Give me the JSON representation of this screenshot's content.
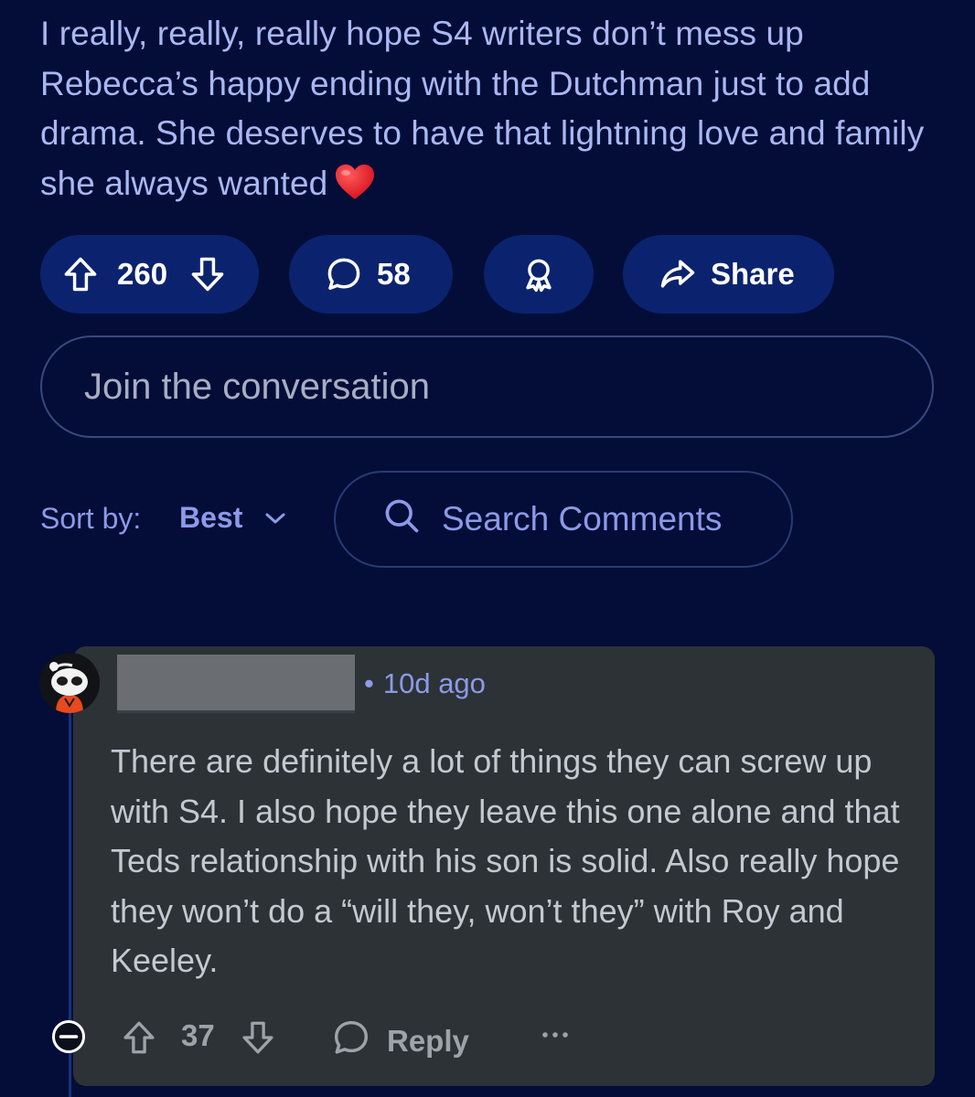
{
  "post": {
    "body": "I really, really, really hope S4 writers don’t mess up Rebecca’s happy ending with the Dutchman just to add drama. She deserves to have that lightning love and family she always wanted",
    "emoji": "heart-emoji"
  },
  "actions": {
    "score": "260",
    "comments": "58",
    "award_icon": "award-icon",
    "share_label": "Share"
  },
  "composer": {
    "placeholder": "Join the conversation"
  },
  "sort": {
    "label": "Sort by:",
    "value": "Best"
  },
  "search": {
    "label": "Search Comments"
  },
  "comment": {
    "author": "",
    "dot": "•",
    "age": "10d ago",
    "text": "There are definitely a lot of things they can screw up with S4. I also hope they leave this one alone and that Teds relationship with his son is solid. Also really hope they won’t do a “will they, won’t they” with Roy and Keeley.",
    "score": "37",
    "reply_label": "Reply"
  },
  "colors": {
    "background": "#030d38",
    "pill": "#0b236e",
    "accent": "#8c9ae8",
    "card": "#2d3236"
  }
}
